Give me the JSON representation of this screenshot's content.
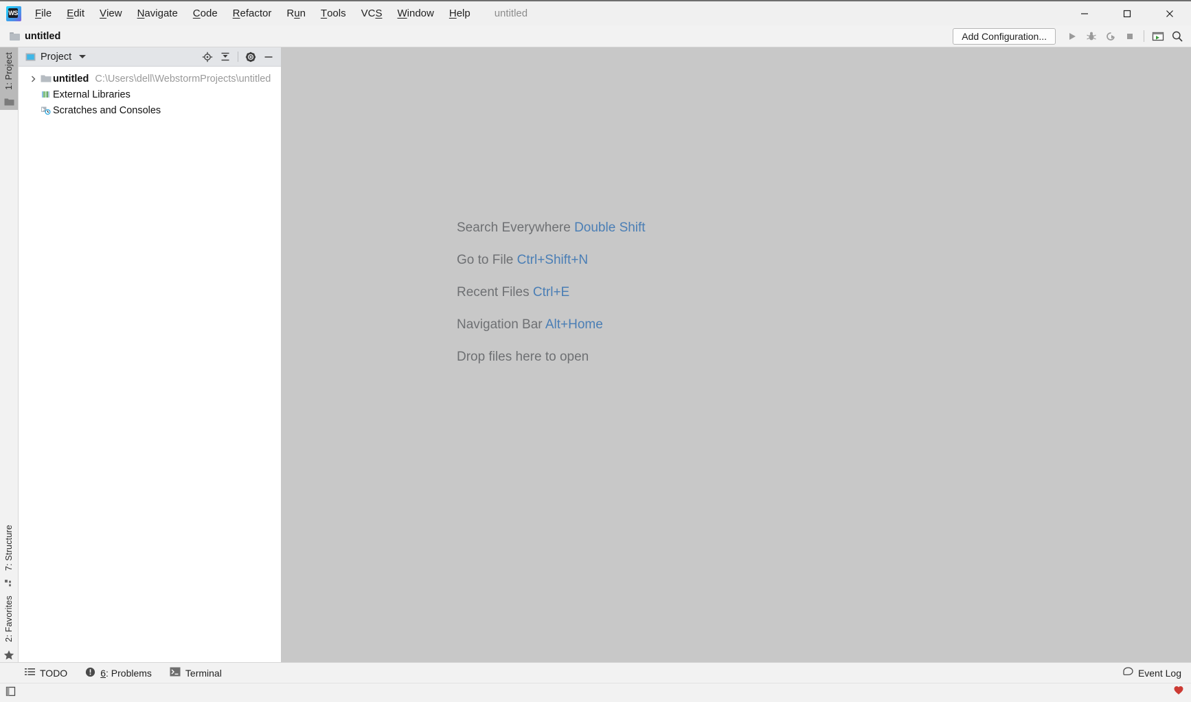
{
  "titlebar": {
    "logo_name": "webstorm-logo",
    "window_title": "untitled",
    "menus": [
      {
        "pre": "",
        "hot": "F",
        "post": "ile"
      },
      {
        "pre": "",
        "hot": "E",
        "post": "dit"
      },
      {
        "pre": "",
        "hot": "V",
        "post": "iew"
      },
      {
        "pre": "",
        "hot": "N",
        "post": "avigate"
      },
      {
        "pre": "",
        "hot": "C",
        "post": "ode"
      },
      {
        "pre": "",
        "hot": "R",
        "post": "efactor"
      },
      {
        "pre": "R",
        "hot": "u",
        "post": "n"
      },
      {
        "pre": "",
        "hot": "T",
        "post": "ools"
      },
      {
        "pre": "VC",
        "hot": "S",
        "post": ""
      },
      {
        "pre": "",
        "hot": "W",
        "post": "indow"
      },
      {
        "pre": "",
        "hot": "H",
        "post": "elp"
      }
    ],
    "window_buttons": [
      {
        "name": "minimize-button",
        "label": "Minimize"
      },
      {
        "name": "maximize-button",
        "label": "Maximize"
      },
      {
        "name": "close-button",
        "label": "Close"
      }
    ]
  },
  "navbar": {
    "breadcrumb": "untitled",
    "add_configuration_label": "Add Configuration...",
    "buttons": [
      {
        "name": "run-button",
        "label": "Run"
      },
      {
        "name": "debug-button",
        "label": "Debug"
      },
      {
        "name": "run-with-coverage-button",
        "label": "Run with Coverage"
      },
      {
        "name": "stop-button",
        "label": "Stop"
      },
      {
        "name": "open-console-button",
        "label": "Console"
      },
      {
        "name": "search-everywhere-button",
        "label": "Search"
      }
    ]
  },
  "left_strip": {
    "tabs": [
      {
        "name": "sidebar-tab-project",
        "pre": "1: Project",
        "hot": "",
        "selected": true
      },
      {
        "name": "sidebar-tab-structure",
        "pre": "7: Structure",
        "hot": "",
        "selected": false
      },
      {
        "name": "sidebar-tab-favorites",
        "pre": "2: Favorites",
        "hot": "",
        "selected": false
      }
    ]
  },
  "project_panel": {
    "title": "Project",
    "actions": [
      {
        "name": "select-opened-file-icon",
        "label": "Select Opened File"
      },
      {
        "name": "collapse-all-icon",
        "label": "Collapse All"
      },
      {
        "name": "settings-gear-icon",
        "label": "Settings"
      },
      {
        "name": "hide-panel-icon",
        "label": "Hide"
      }
    ],
    "tree": [
      {
        "name": "tree-item-project-root",
        "label": "untitled",
        "path": "C:\\Users\\dell\\WebstormProjects\\untitled",
        "icon": "folder-icon",
        "expandable": true,
        "bold": true
      },
      {
        "name": "tree-item-external-libraries",
        "label": "External Libraries",
        "path": "",
        "icon": "libraries-icon",
        "expandable": false,
        "bold": false
      },
      {
        "name": "tree-item-scratches-and-consoles",
        "label": "Scratches and Consoles",
        "path": "",
        "icon": "scratches-icon",
        "expandable": false,
        "bold": false
      }
    ]
  },
  "editor": {
    "hints": [
      {
        "name": "hint-search-everywhere",
        "text": "Search Everywhere",
        "key": "Double Shift"
      },
      {
        "name": "hint-go-to-file",
        "text": "Go to File",
        "key": "Ctrl+Shift+N"
      },
      {
        "name": "hint-recent-files",
        "text": "Recent Files",
        "key": "Ctrl+E"
      },
      {
        "name": "hint-navigation-bar",
        "text": "Navigation Bar",
        "key": "Alt+Home"
      },
      {
        "name": "hint-drop-files",
        "text": "Drop files here to open",
        "key": ""
      }
    ]
  },
  "statusbar": {
    "items": [
      {
        "name": "status-item-todo",
        "pre": "TODO",
        "hot": "",
        "post": "",
        "icon": "todo-list-icon"
      },
      {
        "name": "status-item-problems",
        "pre": "",
        "hot": "6",
        "post": ": Problems",
        "icon": "problems-icon"
      },
      {
        "name": "status-item-terminal",
        "pre": "Terminal",
        "hot": "",
        "post": "",
        "icon": "terminal-icon"
      }
    ],
    "event_log_label": "Event Log"
  },
  "colors": {
    "accent_blue": "#4a7eb5",
    "editor_bg": "#c8c8c8",
    "panel_header": "#e3e5e8",
    "notification_red": "#cc3a33"
  }
}
